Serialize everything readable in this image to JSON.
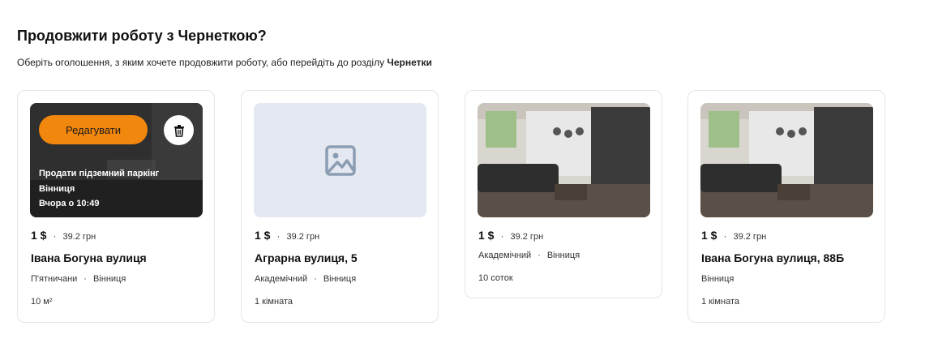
{
  "heading": "Продовжити роботу з Чернеткою?",
  "subtitle": {
    "text": "Оберіть оголошення, з яким хочете продовжити роботу, або перейдіть до розділу ",
    "link": "Чернетки"
  },
  "first_card_overlay": {
    "edit_label": "Редагувати",
    "delete_icon": "trash-icon",
    "ad_title": "Продати підземний паркінг",
    "city": "Вінниця",
    "time": "Вчора о 10:49"
  },
  "cards": [
    {
      "price_main": "1 $",
      "price_sub": "39.2 грн",
      "title": "Івана Богуна вулиця",
      "district": "П'ятничани",
      "city": "Вінниця",
      "extra": "10 м²"
    },
    {
      "image_icon": "image-placeholder-icon",
      "price_main": "1 $",
      "price_sub": "39.2 грн",
      "title": "Аграрна вулиця, 5",
      "district": "Академічний",
      "city": "Вінниця",
      "extra": "1 кімната"
    },
    {
      "price_main": "1 $",
      "price_sub": "39.2 грн",
      "title": "",
      "district": "Академічний",
      "city": "Вінниця",
      "extra": "10 соток"
    },
    {
      "price_main": "1 $",
      "price_sub": "39.2 грн",
      "title": "Івана Богуна вулиця, 88Б",
      "district": "",
      "city": "Вінниця",
      "extra": "1 кімната"
    }
  ],
  "colors": {
    "accent": "#f2870d",
    "placeholder_bg": "#e4e8f0",
    "placeholder_icon": "#8b9db3",
    "border": "#e3e5ea"
  }
}
